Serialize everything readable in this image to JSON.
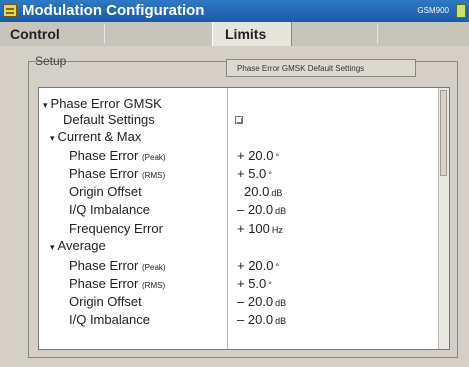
{
  "window": {
    "title": "Modulation Configuration",
    "indicator": "GSM900"
  },
  "tabs": [
    {
      "label": "Control",
      "active": false
    },
    {
      "label": "Limits",
      "active": true
    }
  ],
  "setup": {
    "label": "Setup",
    "field_value": "Phase Error GMSK Default Settings"
  },
  "tree": {
    "section": "Phase Error GMSK",
    "default_settings_label": "Default Settings",
    "current": {
      "label": "Current & Max",
      "rows": [
        {
          "label": "Phase Error",
          "qualifier": "(Peak)",
          "value": "+ 20.0",
          "unit": "°"
        },
        {
          "label": "Phase Error",
          "qualifier": "(RMS)",
          "value": "+ 5.0",
          "unit": "°"
        },
        {
          "label": "Origin Offset",
          "qualifier": "",
          "value": "20.0",
          "unit": "dB"
        },
        {
          "label": "I/Q Imbalance",
          "qualifier": "",
          "value": "– 20.0",
          "unit": "dB"
        },
        {
          "label": "Frequency Error",
          "qualifier": "",
          "value": "+ 100",
          "unit": "Hz"
        }
      ]
    },
    "average": {
      "label": "Average",
      "rows": [
        {
          "label": "Phase Error",
          "qualifier": "(Peak)",
          "value": "+ 20.0",
          "unit": "°"
        },
        {
          "label": "Phase Error",
          "qualifier": "(RMS)",
          "value": "+ 5.0",
          "unit": "°"
        },
        {
          "label": "Origin Offset",
          "qualifier": "",
          "value": "– 20.0",
          "unit": "dB"
        },
        {
          "label": "I/Q Imbalance",
          "qualifier": "",
          "value": "– 20.0",
          "unit": "dB"
        }
      ]
    }
  },
  "colors": {
    "title_bar": "#1f63b0",
    "panel": "#d4d0c8",
    "active_tab": "#e7e4dc"
  }
}
